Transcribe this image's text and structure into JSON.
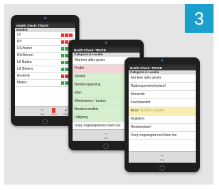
{
  "step_number": "3",
  "colors": {
    "accent": "#1b9fcd",
    "red": "#e0392f",
    "green": "#3aa64a",
    "row_green": "#d5efcf",
    "row_pink": "#f6d4d6",
    "row_yellow": "#f8efb2"
  },
  "tablet1": {
    "title": "Health Check: TRUCK",
    "section": "Banden",
    "rows": [
      {
        "label": "LV",
        "statuses": [
          "red",
          "red",
          "red"
        ]
      },
      {
        "label": "RV",
        "statuses": [
          "red",
          "red",
          "red"
        ]
      },
      {
        "label": "RA Buiten",
        "statuses": [
          "green",
          "green",
          "green"
        ]
      },
      {
        "label": "RA Binnen",
        "statuses": [
          "green",
          "green",
          "green"
        ]
      },
      {
        "label": "LA Buiten",
        "statuses": [
          "green",
          "green",
          "green"
        ]
      },
      {
        "label": "LA Binnen",
        "statuses": [
          "green",
          "green",
          "green"
        ]
      },
      {
        "label": "Reserve",
        "statuses": [
          "red",
          "red",
          "red"
        ]
      },
      {
        "label": "Maten",
        "statuses": [
          "green",
          "green",
          "green"
        ]
      }
    ],
    "toolbar": {
      "back_label": "Terug",
      "delete_label": "Wissen",
      "confirm_label": "Opslaan"
    }
  },
  "tablet2": {
    "title": "Health Check: TRUCK",
    "section": "Categorie & Locatie",
    "rows": [
      {
        "label": "Markeer alles groen",
        "tone": "none"
      },
      {
        "label": "Profiel",
        "tone": "pink"
      },
      {
        "label": "Ventiel",
        "tone": "green"
      },
      {
        "label": "Bandenspanning",
        "tone": "green"
      },
      {
        "label": "Wiel",
        "tone": "green"
      },
      {
        "label": "Wielmoeren / bouten",
        "tone": "green"
      },
      {
        "label": "Bandenconditie",
        "tone": "green"
      },
      {
        "label": "Uitlijning",
        "tone": "green"
      },
      {
        "label": "Voeg ongeregistreerd item toe",
        "tone": "none"
      }
    ],
    "toolbar": {
      "back_label": "Terug"
    }
  },
  "tablet3": {
    "title": "Health Check: TRUCK",
    "section": "Categorie & Locatie",
    "rows": [
      {
        "label": "Markeer alles groen",
        "tone": "none"
      },
      {
        "label": "Ruitensproeiervloeistof",
        "tone": "none"
      },
      {
        "label": "Motorolie",
        "tone": "none"
      },
      {
        "label": "Koelvloeistof",
        "tone": "none"
      },
      {
        "label": "Accu",
        "note": "Slechte conditie",
        "tone": "yellow"
      },
      {
        "label": "Multiitem",
        "tone": "none"
      },
      {
        "label": "Remvloeistof",
        "tone": "none"
      },
      {
        "label": "Voeg ongeregistreerd item toe",
        "tone": "none"
      }
    ],
    "toolbar": {
      "back_label": "Terug"
    }
  }
}
